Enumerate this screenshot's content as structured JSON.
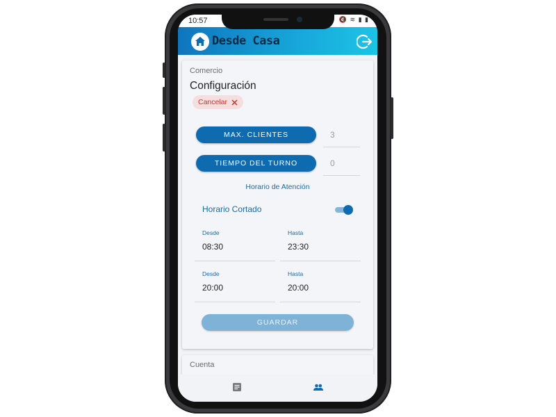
{
  "status": {
    "time": "10:57",
    "icons": "🔇 ≋ ▮ ▮"
  },
  "app": {
    "title": "Desde Casa",
    "home_icon": "home-icon",
    "logout_icon": "logout-icon",
    "brand_color": "#0e6bb0"
  },
  "config": {
    "section_label": "Comercio",
    "title": "Configuración",
    "cancel_label": "Cancelar",
    "max_clients_label": "MAX. CLIENTES",
    "max_clients_value": "3",
    "turn_time_label": "TIEMPO DEL TURNO",
    "turn_time_value": "0",
    "schedule_label": "Horario de Atención",
    "split_schedule_label": "Horario Cortado",
    "split_schedule_on": true,
    "shifts": [
      {
        "from_label": "Desde",
        "from": "08:30",
        "to_label": "Hasta",
        "to": "23:30"
      },
      {
        "from_label": "Desde",
        "from": "20:00",
        "to_label": "Hasta",
        "to": "20:00"
      }
    ],
    "save_label": "GUARDAR"
  },
  "account": {
    "section_label": "Cuenta"
  },
  "bottom_nav": [
    {
      "icon": "document-icon"
    },
    {
      "icon": "people-icon"
    }
  ]
}
